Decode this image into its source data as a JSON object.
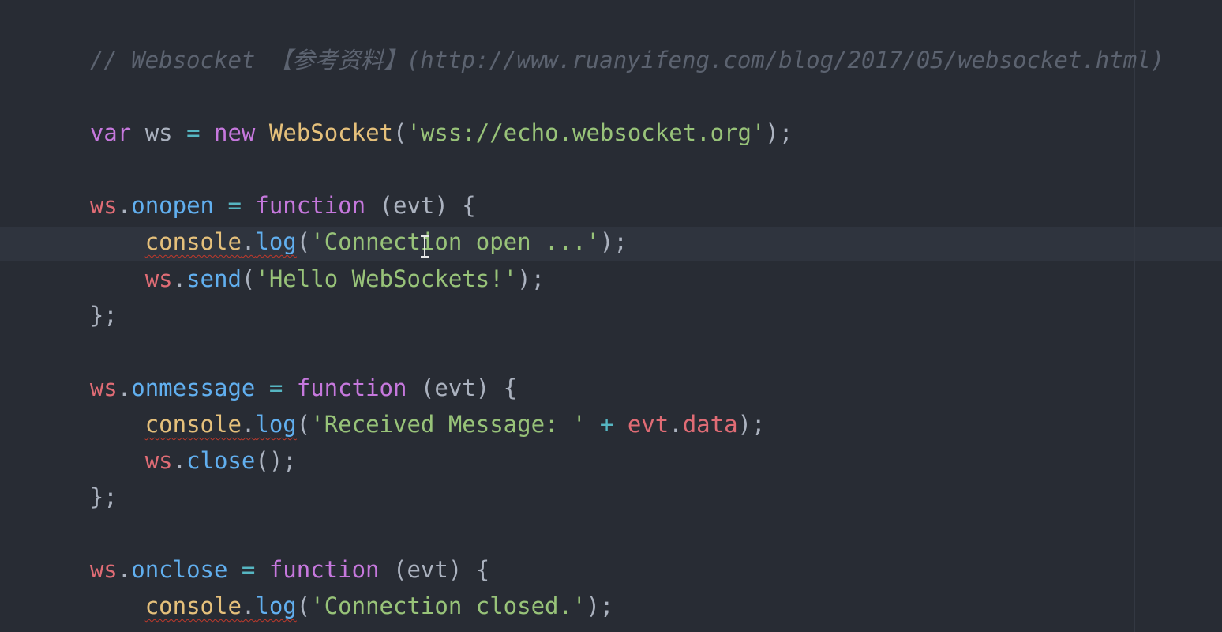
{
  "editor": {
    "theme_colors": {
      "background": "#282c34",
      "comment": "#5c6370",
      "keyword": "#c678dd",
      "string": "#98c379",
      "class": "#e5c07b",
      "object": "#e06c75",
      "property": "#61afef",
      "operator": "#56b6c2",
      "plain": "#abb2bf"
    },
    "cursor_icon": "text-ibeam-icon",
    "lines": {
      "l1": {
        "comment": "// Websocket 【参考资料】(http://www.ruanyifeng.com/blog/2017/05/websocket.html)"
      },
      "l3": {
        "kw_var": "var",
        "ident": " ws ",
        "eq": "=",
        "kw_new": " new ",
        "cls": "WebSocket",
        "p1": "(",
        "str": "'wss://echo.websocket.org'",
        "p2": ");"
      },
      "l5": {
        "obj": "ws",
        "dot": ".",
        "prop": "onopen",
        "eq": " = ",
        "kw": "function",
        "args": " (evt) {"
      },
      "l6": {
        "indent": "    ",
        "obj": "console",
        "dot": ".",
        "method": "log",
        "p1": "(",
        "str": "'Connection open ...'",
        "p2": ");"
      },
      "l7": {
        "indent": "    ",
        "obj": "ws",
        "dot": ".",
        "method": "send",
        "p1": "(",
        "str": "'Hello WebSockets!'",
        "p2": ");"
      },
      "l8": {
        "text": "};"
      },
      "l10": {
        "obj": "ws",
        "dot": ".",
        "prop": "onmessage",
        "eq": " = ",
        "kw": "function",
        "args": " (evt) {"
      },
      "l11": {
        "indent": "    ",
        "obj": "console",
        "dot": ".",
        "method": "log",
        "p1": "(",
        "str": "'Received Message: '",
        "plus": " + ",
        "obj2": "evt",
        "dot2": ".",
        "prop2": "data",
        "p2": ");"
      },
      "l12": {
        "indent": "    ",
        "obj": "ws",
        "dot": ".",
        "method": "close",
        "p2": "();"
      },
      "l13": {
        "text": "};"
      },
      "l15": {
        "obj": "ws",
        "dot": ".",
        "prop": "onclose",
        "eq": " = ",
        "kw": "function",
        "args": " (evt) {"
      },
      "l16": {
        "indent": "    ",
        "obj": "console",
        "dot": ".",
        "method": "log",
        "p1": "(",
        "str": "'Connection closed.'",
        "p2": ");"
      },
      "l17": {
        "text": "};"
      }
    }
  }
}
